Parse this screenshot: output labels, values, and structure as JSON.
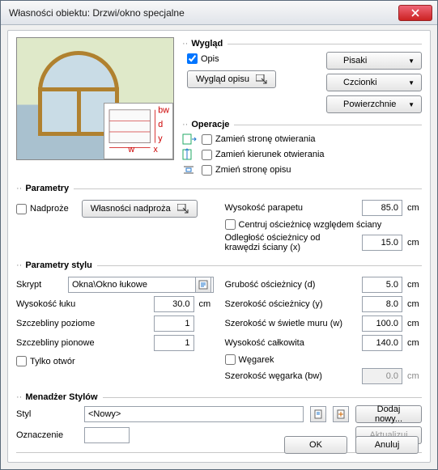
{
  "window": {
    "title": "Własności obiektu: Drzwi/okno specjalne"
  },
  "wyglad": {
    "title": "Wygląd",
    "opis": "Opis",
    "wyglad_opisu": "Wygląd opisu",
    "pisaki": "Pisaki",
    "czcionki": "Czcionki",
    "powierzchnie": "Powierzchnie"
  },
  "operacje": {
    "title": "Operacje",
    "swap_side": "Zamień stronę otwierania",
    "swap_dir": "Zamień kierunek otwierania",
    "swap_desc": "Zmień stronę opisu"
  },
  "parametry": {
    "title": "Parametry",
    "nadproze": "Nadproże",
    "wlasnosci_nadproza": "Własności nadproża",
    "wys_parapetu_label": "Wysokość parapetu",
    "wys_parapetu": "85.0",
    "centruj": "Centruj ościeżnicę względem ściany",
    "odleglosc_label": "Odległość ościeżnicy od krawędzi ściany (x)",
    "odleglosc": "15.0"
  },
  "stylu": {
    "title": "Parametry stylu",
    "skrypt": "Skrypt",
    "skrypt_val": "Okna\\Okno łukowe",
    "wys_luku_label": "Wysokość łuku",
    "wys_luku": "30.0",
    "szcz_poz_label": "Szczebliny poziome",
    "szcz_poz": "1",
    "szcz_pio_label": "Szczebliny pionowe",
    "szcz_pio": "1",
    "tylko_otwor": "Tylko otwór",
    "grubosc_label": "Grubość ościeżnicy (d)",
    "grubosc": "5.0",
    "szerokosc_label": "Szerokość ościeżnicy (y)",
    "szerokosc": "8.0",
    "swietlo_label": "Szerokość w świetle muru (w)",
    "swietlo": "100.0",
    "wys_calk_label": "Wysokość całkowita",
    "wys_calk": "140.0",
    "wegarek": "Węgarek",
    "szer_weg_label": "Szerokość węgarka (bw)",
    "szer_weg": "0.0"
  },
  "menadzer": {
    "title": "Menadżer Stylów",
    "styl": "Styl",
    "styl_val": "<Nowy>",
    "dodaj": "Dodaj nowy...",
    "oznaczenie": "Oznaczenie",
    "aktualizuj": "Aktualizuj"
  },
  "buttons": {
    "ok": "OK",
    "anuluj": "Anuluj"
  },
  "unit": "cm"
}
